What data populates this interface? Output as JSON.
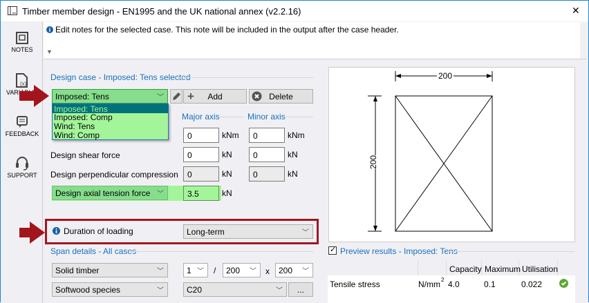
{
  "window": {
    "title": "Timber member design - EN1995 and the UK national annex (v2.2.16)",
    "close": "✕"
  },
  "sidebar": {
    "items": [
      {
        "label": "NOTES",
        "icon": "notes-icon"
      },
      {
        "label": "VARIABLES",
        "icon": "variables-icon"
      },
      {
        "label": "FEEDBACK",
        "icon": "feedback-icon"
      },
      {
        "label": "SUPPORT",
        "icon": "headset-icon"
      }
    ],
    "visible_variables": "VAR"
  },
  "notes": {
    "text": "Edit notes for the selected case. This note will be included in the output after the case header."
  },
  "design_case": {
    "heading": "Design case - Imposed: Tens selected",
    "selected": "Imposed: Tens",
    "options": [
      "Imposed: Tens",
      "Imposed: Comp",
      "Wind: Tens",
      "Wind: Comp"
    ],
    "add_label": "Add",
    "delete_label": "Delete"
  },
  "forces": {
    "major_axis": "Major axis",
    "minor_axis": "Minor axis",
    "rows": [
      {
        "label": "",
        "major": "0",
        "minor": "0",
        "unit_major": "kNm",
        "unit_minor": "kNm"
      },
      {
        "label": "Design shear force",
        "major": "0",
        "minor": "0",
        "unit_major": "kN",
        "unit_minor": "kN"
      },
      {
        "label": "Design perpendicular compression",
        "major": "0",
        "minor": "0",
        "unit_major": "kN",
        "unit_minor": "kN"
      }
    ],
    "axial": {
      "label": "Design axial tension force",
      "value": "3.5",
      "unit": "kN"
    }
  },
  "duration": {
    "label": "Duration of loading",
    "value": "Long-term"
  },
  "span": {
    "heading": "Span details - All cases",
    "section_type": "Solid timber",
    "count": "1",
    "slash": "/",
    "width": "200",
    "times": "x",
    "depth": "200",
    "species": "Softwood species",
    "grade": "C20",
    "more": "..."
  },
  "drawing": {
    "width_dim": "200",
    "height_dim": "200"
  },
  "preview": {
    "heading": "Preview results - Imposed: Tens",
    "checked": true,
    "columns": [
      "Capacity",
      "Maximum",
      "Utilisation"
    ],
    "rows": [
      {
        "label": "Tensile stress",
        "unit": "N/mm",
        "unit_sup": "2",
        "capacity": "4.0",
        "maximum": "0.1",
        "utilisation": "0.022",
        "status": "ok"
      }
    ]
  },
  "colors": {
    "accent": "#1a6fbf",
    "green_field": "#86de8c",
    "highlight_box": "#a3151c",
    "ok": "#5aa832"
  }
}
